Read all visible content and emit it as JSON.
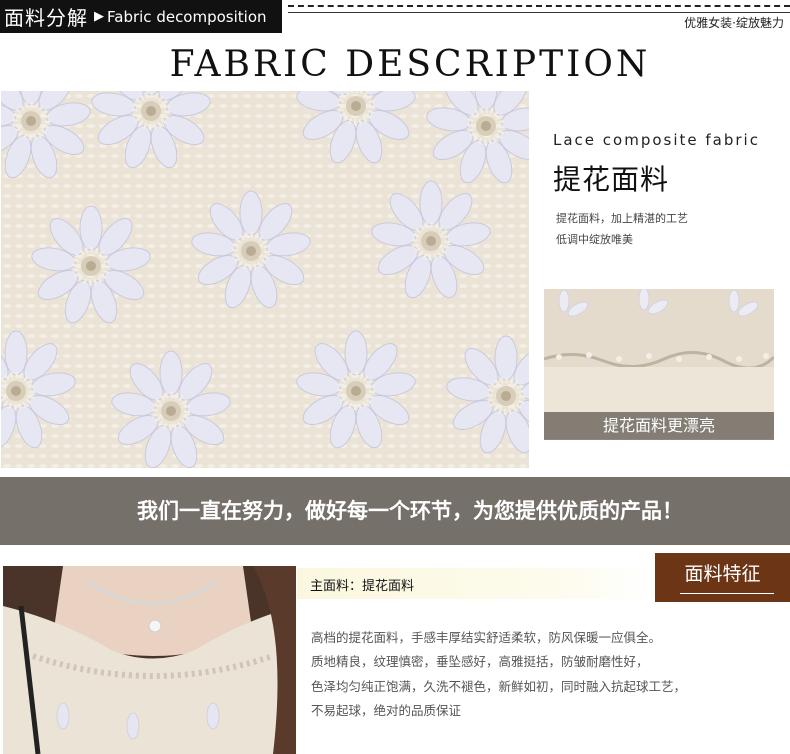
{
  "header": {
    "title_cn": "面料分解",
    "arrow": "▶",
    "title_en": "Fabric decomposition",
    "tagline": "优雅女装·绽放魅力"
  },
  "main_title": "FABRIC DESCRIPTION",
  "lace": {
    "en": "Lace composite fabric",
    "cn": "提花面料",
    "desc_line1": "提花面料，加上精湛的工艺",
    "desc_line2": "低调中绽放唯美",
    "small_caption": "提花面料更漂亮"
  },
  "banner": "我们一直在努力，做好每一个环节，为您提供优质的产品！",
  "feature": {
    "label": "面料特征",
    "main_fabric": "主面料：提花面料",
    "lines": [
      "高档的提花面料，手感丰厚结实舒适柔软，防风保暖一应俱全。",
      "质地精良，纹理慎密，垂坠感好，高雅挺括，防皱耐磨性好，",
      "色泽均匀纯正饱满，久洗不褪色，新鲜如初，同时融入抗起球工艺，",
      "不易起球，绝对的品质保证"
    ]
  },
  "colors": {
    "header_bg": "#111111",
    "banner_bg": "#76706a",
    "label_bg": "#6b3516",
    "fabric_bg": "#e8e0d2",
    "petal": "#e6e6f2"
  }
}
